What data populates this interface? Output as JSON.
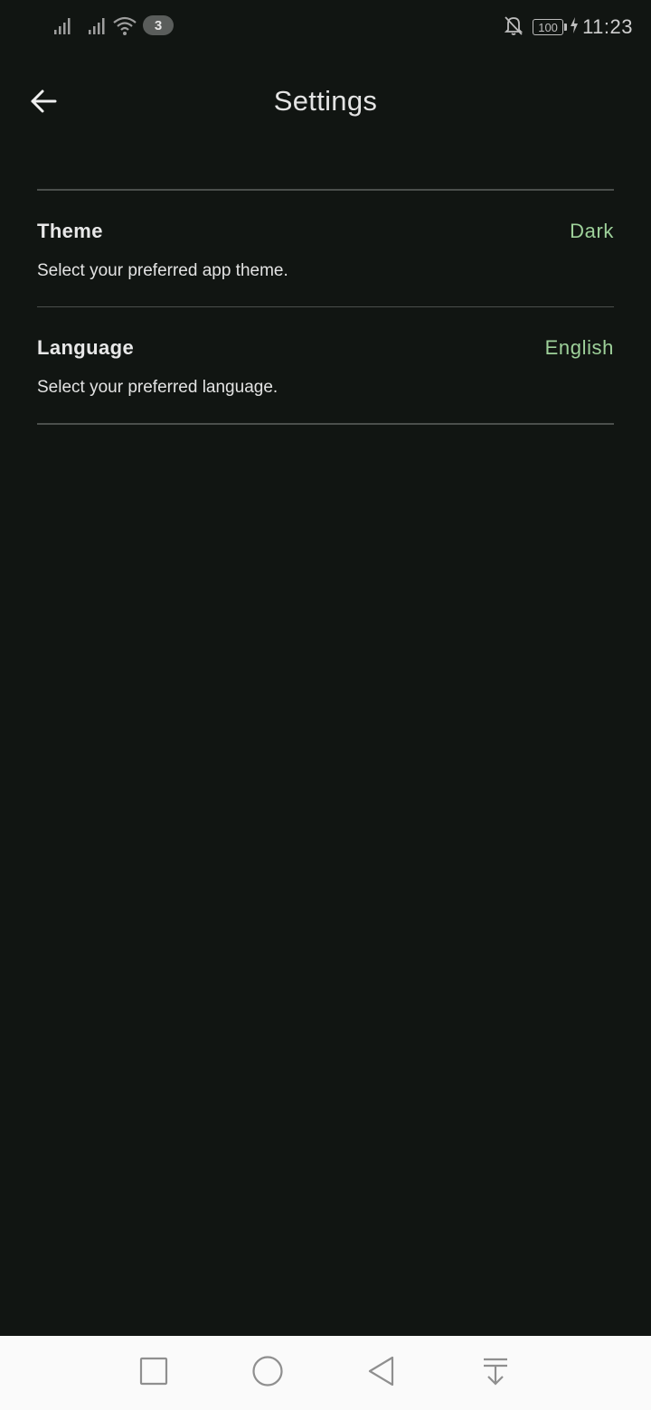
{
  "status_bar": {
    "notification_count": "3",
    "battery_level": "100",
    "time": "11:23",
    "icons": [
      "signal-icon",
      "signal-icon",
      "wifi-icon",
      "bell-off-icon",
      "battery-icon",
      "charging-icon"
    ]
  },
  "app_bar": {
    "title": "Settings",
    "back_icon": "arrow-left-icon"
  },
  "settings": {
    "items": [
      {
        "label": "Theme",
        "value": "Dark",
        "description": "Select your preferred app theme."
      },
      {
        "label": "Language",
        "value": "English",
        "description": "Select your preferred language."
      }
    ]
  },
  "nav_bar": {
    "icons": [
      "recents-square-icon",
      "home-circle-icon",
      "back-triangle-icon",
      "notification-pull-down-icon"
    ]
  },
  "colors": {
    "background": "#111512",
    "accent_value": "#9ed19a",
    "divider": "#4b4f4c",
    "nav_bar_background": "#fafafa"
  }
}
